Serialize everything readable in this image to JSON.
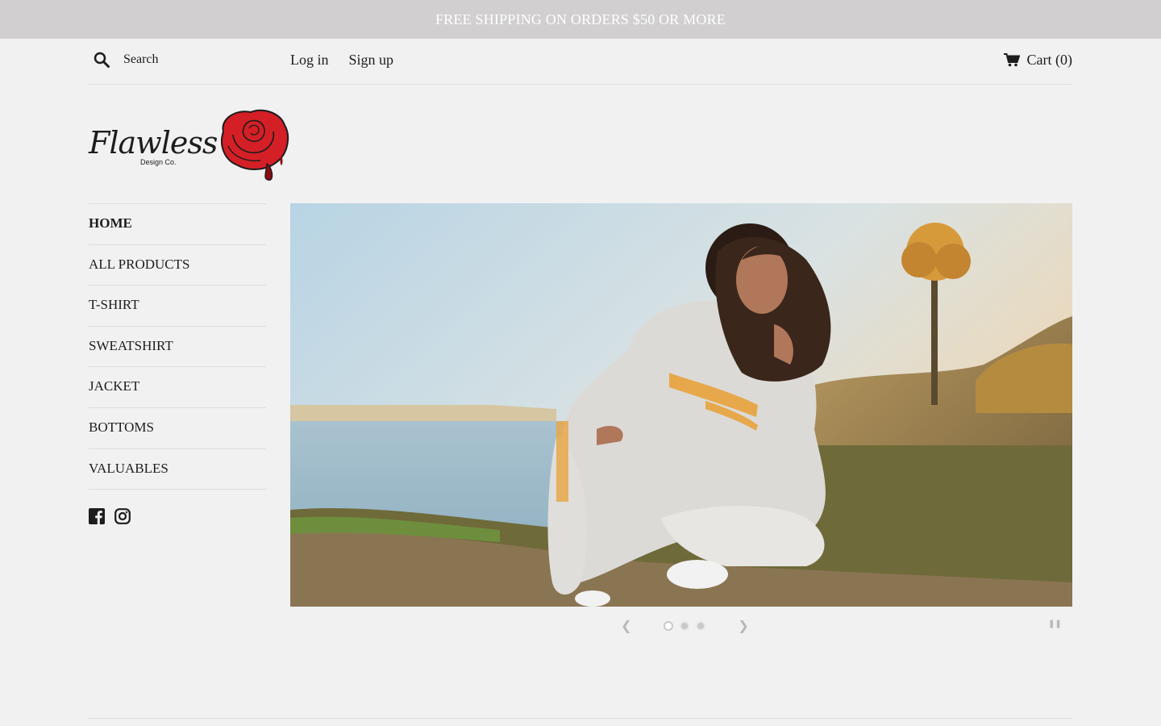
{
  "announcement": "FREE SHIPPING ON ORDERS $50 OR MORE",
  "header": {
    "search_placeholder": "Search",
    "login_label": "Log in",
    "signup_label": "Sign up",
    "cart_label": "Cart (0)"
  },
  "logo": {
    "wordmark": "Flawless",
    "subtitle": "Design Co.",
    "accent_color": "#d41f26"
  },
  "nav": {
    "items": [
      {
        "label": "HOME",
        "active": true
      },
      {
        "label": "ALL PRODUCTS"
      },
      {
        "label": "T-SHIRT"
      },
      {
        "label": "SWEATSHIRT"
      },
      {
        "label": "JACKET"
      },
      {
        "label": "BOTTOMS"
      },
      {
        "label": "VALUABLES"
      }
    ]
  },
  "social": [
    "facebook-icon",
    "instagram-icon"
  ],
  "slideshow": {
    "slide_count": 3,
    "active_slide": 1,
    "prev_icon": "chevron-left-icon",
    "next_icon": "chevron-right-icon",
    "pause_icon": "pause-icon"
  },
  "colors": {
    "announcement_bg": "#d1cfd0",
    "page_bg": "#f1f1f1",
    "text": "#1c1d1d"
  }
}
